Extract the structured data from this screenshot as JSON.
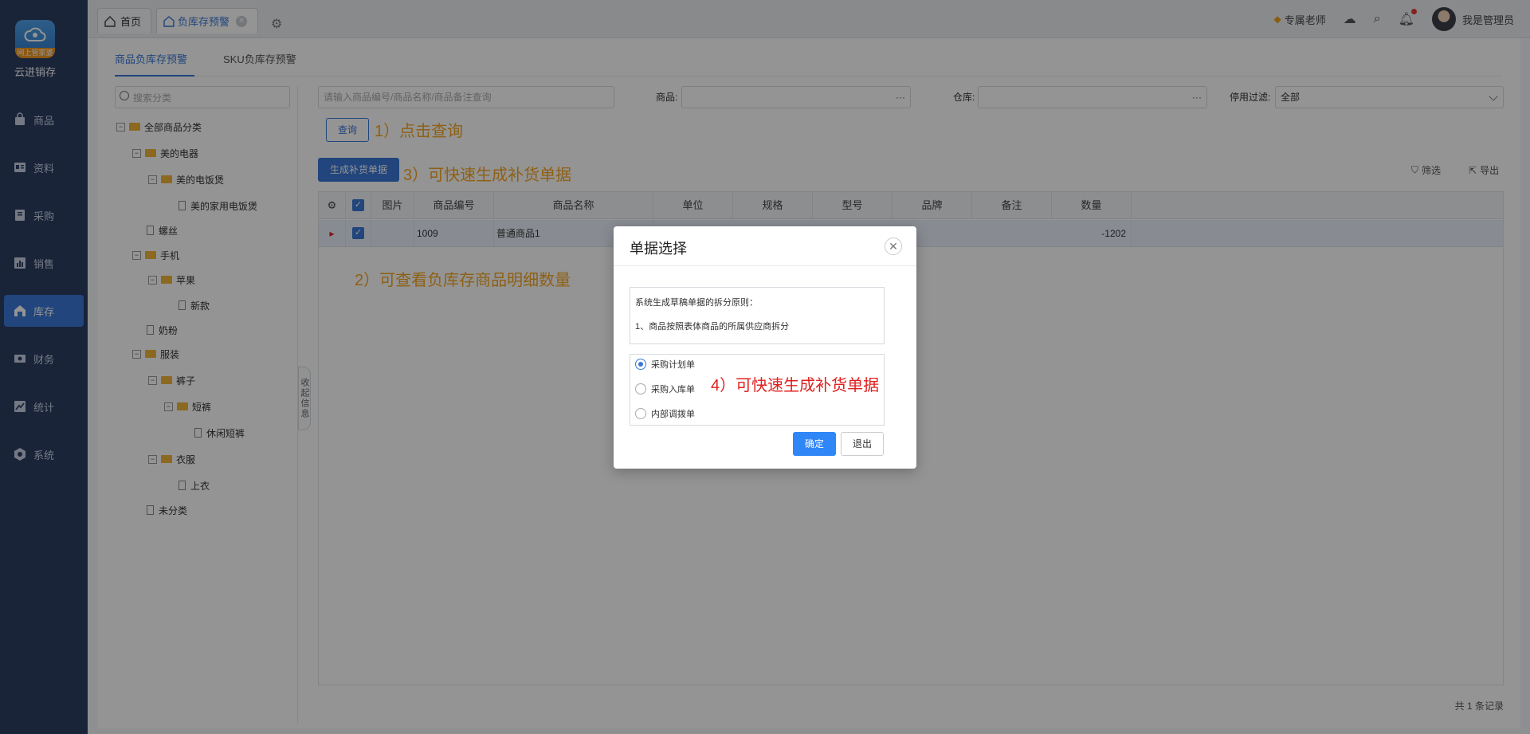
{
  "app": {
    "brand": "云进销存",
    "logo_badge": "网上管家婆"
  },
  "sidebar": {
    "items": [
      {
        "label": "商品",
        "icon": "bag-icon"
      },
      {
        "label": "资料",
        "icon": "profile-card-icon"
      },
      {
        "label": "采购",
        "icon": "purchase-book-icon"
      },
      {
        "label": "销售",
        "icon": "bar-chart-icon"
      },
      {
        "label": "库存",
        "icon": "warehouse-icon",
        "active": true
      },
      {
        "label": "财务",
        "icon": "money-icon"
      },
      {
        "label": "统计",
        "icon": "trend-icon"
      },
      {
        "label": "系统",
        "icon": "settings-icon"
      }
    ]
  },
  "topbar": {
    "tabs": [
      {
        "label": "首页"
      },
      {
        "label": "负库存预警",
        "active": true
      }
    ],
    "teacher": "专属老师",
    "user": "我是管理员"
  },
  "subtabs": [
    {
      "label": "商品负库存预警"
    },
    {
      "label": "SKU负库存预警"
    }
  ],
  "tree": {
    "search_placeholder": "搜索分类",
    "nodes": [
      {
        "label": "全部商品分类"
      },
      {
        "label": "美的电器"
      },
      {
        "label": "美的电饭煲"
      },
      {
        "label": "美的家用电饭煲"
      },
      {
        "label": "螺丝"
      },
      {
        "label": "手机"
      },
      {
        "label": "苹果"
      },
      {
        "label": "新款"
      },
      {
        "label": "奶粉"
      },
      {
        "label": "服装"
      },
      {
        "label": "裤子"
      },
      {
        "label": "短裤"
      },
      {
        "label": "休闲短裤"
      },
      {
        "label": "衣服"
      },
      {
        "label": "上衣"
      },
      {
        "label": "未分类"
      }
    ],
    "collapse_label": "收起信息"
  },
  "filters": {
    "search_placeholder": "请输入商品编号/商品名称/商品备注查询",
    "product_label": "商品:",
    "warehouse_label": "仓库:",
    "disable_filter_label": "停用过滤:",
    "disable_filter_value": "全部",
    "query_button": "查询"
  },
  "toolbar": {
    "generate_button": "生成补货单据",
    "filter": "筛选",
    "export": "导出"
  },
  "annotations": {
    "a1": "1）点击查询",
    "a2": "2）可查看负库存商品明细数量",
    "a3": "3）可快速生成补货单据",
    "a4": "4）可快速生成补货单据"
  },
  "table": {
    "columns": [
      "图片",
      "商品编号",
      "商品名称",
      "单位",
      "规格",
      "型号",
      "品牌",
      "备注",
      "数量"
    ],
    "rows": [
      {
        "code": "1009",
        "name": "普通商品1",
        "qty": "-1202"
      }
    ],
    "footer": "共 1 条记录"
  },
  "modal": {
    "title": "单据选择",
    "rule_title": "系统生成草稿单据的拆分原则：",
    "rule_1": "1、商品按照表体商品的所属供应商拆分",
    "options": [
      {
        "label": "采购计划单",
        "selected": true
      },
      {
        "label": "采购入库单",
        "selected": false
      },
      {
        "label": "内部调拨单",
        "selected": false
      }
    ],
    "ok": "确定",
    "exit": "退出"
  }
}
